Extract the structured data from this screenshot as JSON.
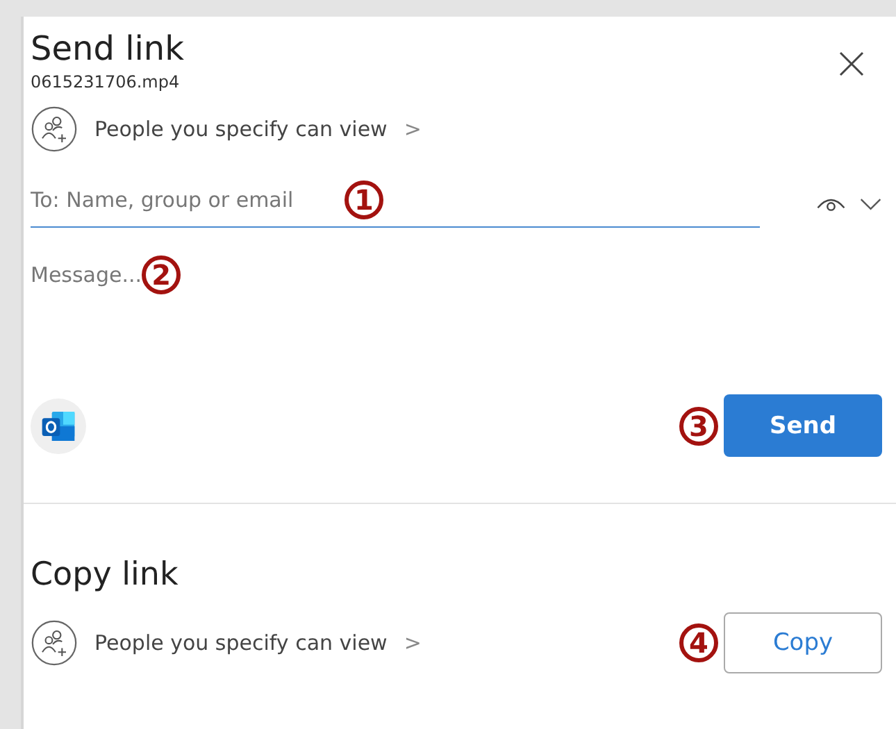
{
  "send_link": {
    "title": "Send link",
    "filename": "0615231706.mp4",
    "permission": "People you specify can view",
    "permission_chevron": ">",
    "to_field": {
      "placeholder": "To: Name, group or email",
      "marker": "1"
    },
    "message_field": {
      "placeholder": "Message...",
      "marker": "2"
    },
    "send_button": {
      "label": "Send",
      "marker": "3"
    }
  },
  "copy_link": {
    "title": "Copy link",
    "permission": "People you specify can view",
    "permission_chevron": ">",
    "copy_button": {
      "label": "Copy",
      "marker": "4"
    }
  }
}
